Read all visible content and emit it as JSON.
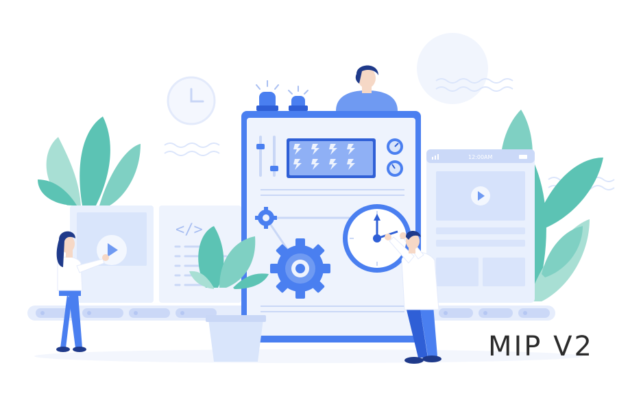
{
  "brand": {
    "label": "MIP V2"
  },
  "phone": {
    "time": "12:00AM"
  },
  "code_card": {
    "symbol": "</>"
  },
  "colors": {
    "primary": "#4a7ff0",
    "primary_dark": "#2f5fd6",
    "panel": "#eef3fd",
    "panel_light": "#f5f8fe",
    "leaf": "#5cc3b4",
    "leaf_light": "#a8dfd4",
    "ink": "#1f3a8a",
    "text": "#2b2b2b"
  },
  "icons": [
    "clock-icon",
    "play-icon",
    "code-icon",
    "gear-icon",
    "alarm-light-icon",
    "gauge-icon",
    "slider-icon",
    "lightning-icon",
    "signal-icon",
    "battery-icon"
  ]
}
